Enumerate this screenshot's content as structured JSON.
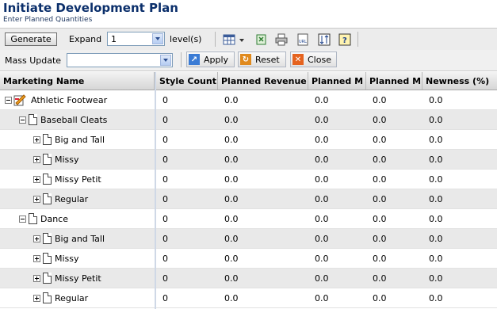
{
  "header": {
    "title": "Initiate Development Plan",
    "subtitle": "Enter Planned Quantities"
  },
  "toolbar": {
    "generate_label": "Generate",
    "expand_label": "Expand",
    "expand_value": "1",
    "levels_label": "level(s)",
    "icons": [
      "table-columns-icon",
      "export-icon",
      "print-icon",
      "url-icon",
      "sort-icon",
      "help-icon"
    ]
  },
  "mass_update": {
    "label": "Mass Update",
    "value": "",
    "apply_label": "Apply",
    "reset_label": "Reset",
    "close_label": "Close"
  },
  "colors": {
    "title": "#0b2f6b",
    "apply": "#3a7bd5",
    "reset": "#e08a1e",
    "close": "#e5631f"
  },
  "grid": {
    "columns": [
      "Marketing Name",
      "Style Count",
      "Planned Revenue",
      "Planned M",
      "Planned M",
      "Newness (%)"
    ],
    "rows": [
      {
        "name": "Athletic Footwear",
        "level": 0,
        "toggle": "minus",
        "icon": "plan-icon",
        "values": [
          "0",
          "0.0",
          "0.0",
          "0.0",
          "0.0"
        ]
      },
      {
        "name": "Baseball Cleats",
        "level": 1,
        "toggle": "minus",
        "icon": "document-icon",
        "values": [
          "0",
          "0.0",
          "0.0",
          "0.0",
          "0.0"
        ]
      },
      {
        "name": "Big and Tall",
        "level": 2,
        "toggle": "plus",
        "icon": "document-icon",
        "values": [
          "0",
          "0.0",
          "0.0",
          "0.0",
          "0.0"
        ]
      },
      {
        "name": "Missy",
        "level": 2,
        "toggle": "plus",
        "icon": "document-icon",
        "values": [
          "0",
          "0.0",
          "0.0",
          "0.0",
          "0.0"
        ]
      },
      {
        "name": "Missy Petit",
        "level": 2,
        "toggle": "plus",
        "icon": "document-icon",
        "values": [
          "0",
          "0.0",
          "0.0",
          "0.0",
          "0.0"
        ]
      },
      {
        "name": "Regular",
        "level": 2,
        "toggle": "plus",
        "icon": "document-icon",
        "values": [
          "0",
          "0.0",
          "0.0",
          "0.0",
          "0.0"
        ]
      },
      {
        "name": "Dance",
        "level": 1,
        "toggle": "minus",
        "icon": "document-icon",
        "values": [
          "0",
          "0.0",
          "0.0",
          "0.0",
          "0.0"
        ]
      },
      {
        "name": "Big and Tall",
        "level": 2,
        "toggle": "plus",
        "icon": "document-icon",
        "values": [
          "0",
          "0.0",
          "0.0",
          "0.0",
          "0.0"
        ]
      },
      {
        "name": "Missy",
        "level": 2,
        "toggle": "plus",
        "icon": "document-icon",
        "values": [
          "0",
          "0.0",
          "0.0",
          "0.0",
          "0.0"
        ]
      },
      {
        "name": "Missy Petit",
        "level": 2,
        "toggle": "plus",
        "icon": "document-icon",
        "values": [
          "0",
          "0.0",
          "0.0",
          "0.0",
          "0.0"
        ]
      },
      {
        "name": "Regular",
        "level": 2,
        "toggle": "plus",
        "icon": "document-icon",
        "values": [
          "0",
          "0.0",
          "0.0",
          "0.0",
          "0.0"
        ]
      }
    ]
  }
}
